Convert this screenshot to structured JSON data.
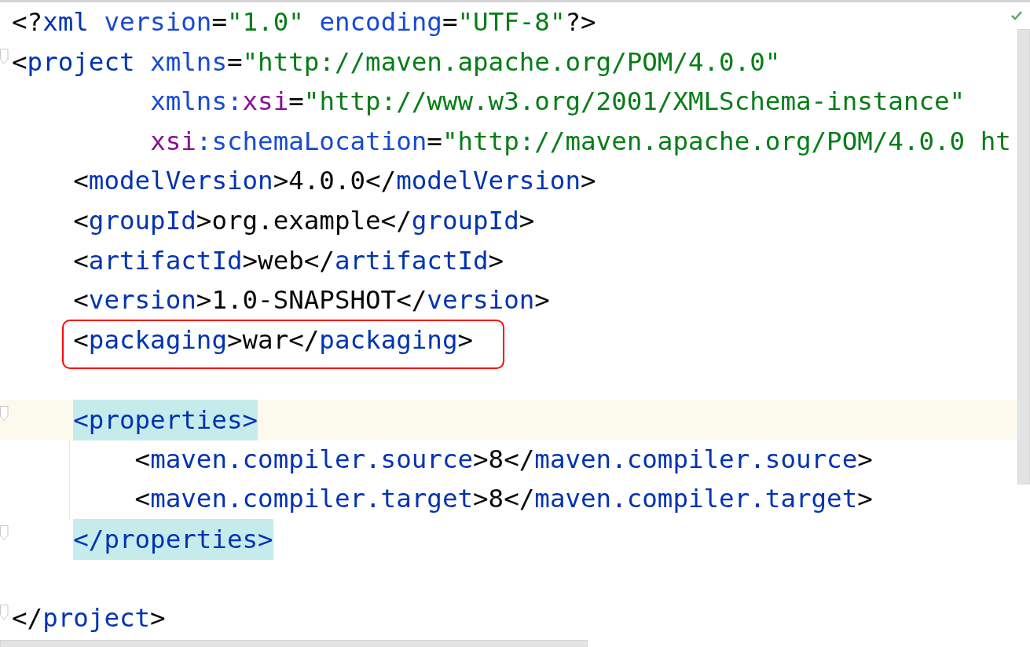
{
  "editor": {
    "inspection_ok": true,
    "lines": [
      {
        "tokens": [
          {
            "kind": "punct",
            "text": "<?"
          },
          {
            "kind": "tag",
            "text": "xml"
          },
          {
            "kind": "attr",
            "text": " version"
          },
          {
            "kind": "punct",
            "text": "="
          },
          {
            "kind": "value",
            "text": "\"1.0\""
          },
          {
            "kind": "attr",
            "text": " encoding"
          },
          {
            "kind": "punct",
            "text": "="
          },
          {
            "kind": "value",
            "text": "\"UTF-8\""
          },
          {
            "kind": "punct",
            "text": "?>"
          }
        ]
      },
      {
        "fold": true,
        "tokens": [
          {
            "kind": "punct",
            "text": "<"
          },
          {
            "kind": "tag",
            "text": "project"
          },
          {
            "kind": "attr",
            "text": " xmlns"
          },
          {
            "kind": "punct",
            "text": "="
          },
          {
            "kind": "value",
            "text": "\"http://maven.apache.org/POM/4.0.0\""
          }
        ],
        "children": [
          {
            "kind": "continuation",
            "tokens": [
              {
                "kind": "attr",
                "text": "xmlns:"
              },
              {
                "kind": "ns",
                "text": "xsi"
              },
              {
                "kind": "punct",
                "text": "="
              },
              {
                "kind": "value",
                "text": "\"http://www.w3.org/2001/XMLSchema-instance\""
              }
            ]
          },
          {
            "kind": "continuation",
            "tokens": [
              {
                "kind": "ns",
                "text": "xsi"
              },
              {
                "kind": "attr",
                "text": ":schemaLocation"
              },
              {
                "kind": "punct",
                "text": "="
              },
              {
                "kind": "value",
                "text": "\"http://maven.apache.org/POM/4.0.0 ht"
              }
            ]
          },
          {
            "tokens": [
              {
                "kind": "punct",
                "text": "<"
              },
              {
                "kind": "tag",
                "text": "modelVersion"
              },
              {
                "kind": "punct",
                "text": ">4.0.0</"
              },
              {
                "kind": "tag",
                "text": "modelVersion"
              },
              {
                "kind": "punct",
                "text": ">"
              }
            ]
          },
          {
            "tokens": [
              {
                "kind": "punct",
                "text": "<"
              },
              {
                "kind": "tag",
                "text": "groupId"
              },
              {
                "kind": "punct",
                "text": ">org.example</"
              },
              {
                "kind": "tag",
                "text": "groupId"
              },
              {
                "kind": "punct",
                "text": ">"
              }
            ]
          },
          {
            "tokens": [
              {
                "kind": "punct",
                "text": "<"
              },
              {
                "kind": "tag",
                "text": "artifactId"
              },
              {
                "kind": "punct",
                "text": ">web</"
              },
              {
                "kind": "tag",
                "text": "artifactId"
              },
              {
                "kind": "punct",
                "text": ">"
              }
            ]
          },
          {
            "tokens": [
              {
                "kind": "punct",
                "text": "<"
              },
              {
                "kind": "tag",
                "text": "version"
              },
              {
                "kind": "punct",
                "text": ">1.0-SNAPSHOT</"
              },
              {
                "kind": "tag",
                "text": "version"
              },
              {
                "kind": "punct",
                "text": ">"
              }
            ]
          },
          {
            "annotated": true,
            "tokens": [
              {
                "kind": "punct",
                "text": "<"
              },
              {
                "kind": "tag",
                "text": "packaging"
              },
              {
                "kind": "punct",
                "text": ">war</"
              },
              {
                "kind": "tag",
                "text": "packaging"
              },
              {
                "kind": "punct",
                "text": ">"
              }
            ]
          },
          {
            "kind": "blank"
          },
          {
            "current": true,
            "fold": true,
            "tokens": [
              {
                "kind": "match",
                "text": "<properties>"
              }
            ],
            "children": [
              {
                "tokens": [
                  {
                    "kind": "punct",
                    "text": "<"
                  },
                  {
                    "kind": "tag",
                    "text": "maven.compiler.source"
                  },
                  {
                    "kind": "punct",
                    "text": ">8</"
                  },
                  {
                    "kind": "tag",
                    "text": "maven.compiler.source"
                  },
                  {
                    "kind": "punct",
                    "text": ">"
                  }
                ]
              },
              {
                "tokens": [
                  {
                    "kind": "punct",
                    "text": "<"
                  },
                  {
                    "kind": "tag",
                    "text": "maven.compiler.target"
                  },
                  {
                    "kind": "punct",
                    "text": ">8</"
                  },
                  {
                    "kind": "tag",
                    "text": "maven.compiler.target"
                  },
                  {
                    "kind": "punct",
                    "text": ">"
                  }
                ]
              }
            ]
          },
          {
            "fold": true,
            "tokens": [
              {
                "kind": "match",
                "text": "</properties>"
              }
            ]
          },
          {
            "kind": "blank"
          }
        ]
      },
      {
        "fold": true,
        "tokens": [
          {
            "kind": "punct",
            "text": "</"
          },
          {
            "kind": "tag",
            "text": "project"
          },
          {
            "kind": "punct",
            "text": ">"
          }
        ]
      }
    ]
  }
}
